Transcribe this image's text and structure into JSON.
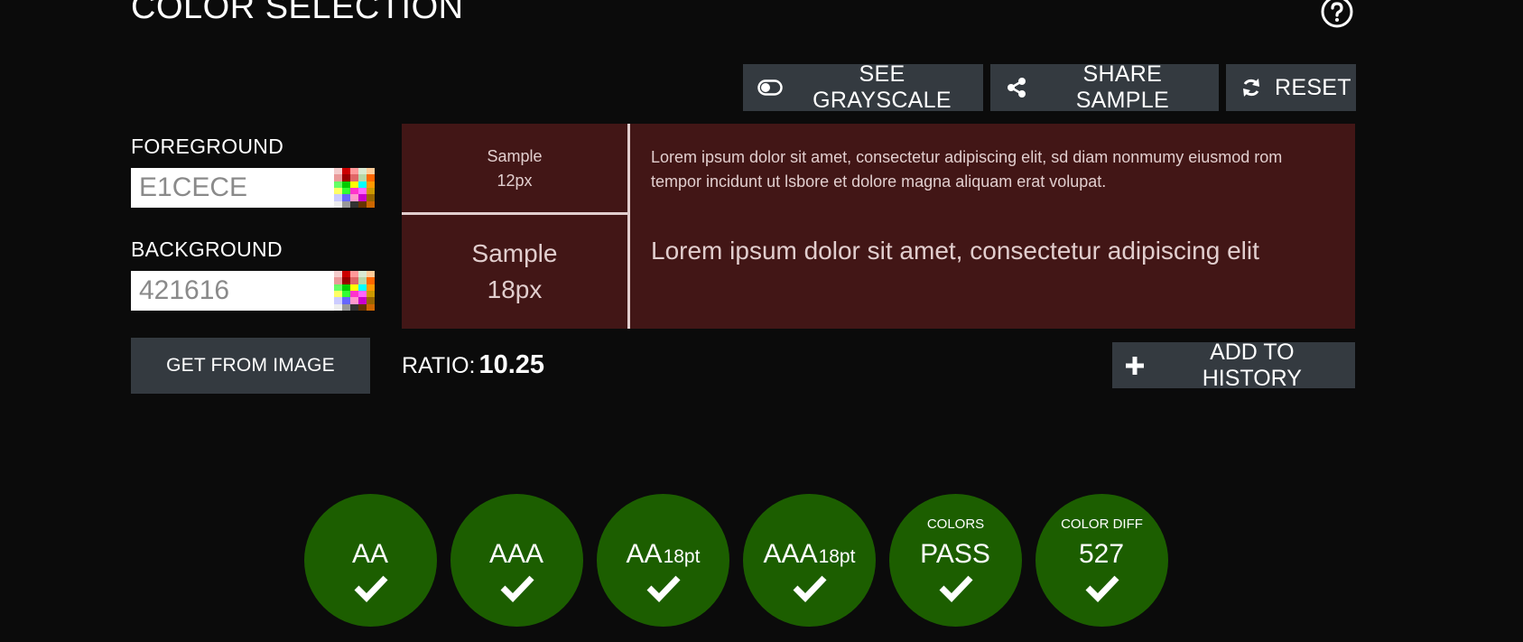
{
  "page": {
    "title": "COLOR SELECTION",
    "help_icon": "question-circle-icon"
  },
  "toolbar": {
    "grayscale": {
      "label": "SEE GRAYSCALE",
      "icon": "toggle-icon"
    },
    "share": {
      "label": "SHARE SAMPLE",
      "icon": "share-icon"
    },
    "reset": {
      "label": "RESET",
      "icon": "refresh-icon"
    }
  },
  "foreground": {
    "label": "FOREGROUND",
    "value": "E1CECE",
    "color": "#E1CECE",
    "palette_icon": "color-palette-icon"
  },
  "background": {
    "label": "BACKGROUND",
    "value": "421616",
    "color": "#421616",
    "palette_icon": "color-palette-icon"
  },
  "get_from_image": {
    "label": "GET FROM IMAGE"
  },
  "preview": {
    "sample_small": {
      "line1": "Sample",
      "line2": "12px"
    },
    "sample_large": {
      "line1": "Sample",
      "line2": "18px"
    },
    "text_small": "Lorem ipsum dolor sit amet, consectetur adipiscing elit, sd diam nonmumy eiusmod rom tempor incidunt ut lsbore et dolore magna aliquam erat volupat.",
    "text_large": "Lorem ipsum dolor sit amet, consectetur adipiscing elit"
  },
  "ratio": {
    "label": "RATIO:",
    "value": "10.25"
  },
  "history": {
    "label": "ADD TO HISTORY",
    "icon": "plus-icon"
  },
  "badges": [
    {
      "small": "",
      "main": "AA",
      "suffix": "",
      "status": "pass",
      "icon": "check-icon"
    },
    {
      "small": "",
      "main": "AAA",
      "suffix": "",
      "status": "pass",
      "icon": "check-icon"
    },
    {
      "small": "",
      "main": "AA",
      "suffix": "18pt",
      "status": "pass",
      "icon": "check-icon"
    },
    {
      "small": "",
      "main": "AAA",
      "suffix": "18pt",
      "status": "pass",
      "icon": "check-icon"
    },
    {
      "small": "COLORS",
      "main": "PASS",
      "suffix": "",
      "status": "pass",
      "icon": "check-icon"
    },
    {
      "small": "COLOR DIFF",
      "main": "527",
      "suffix": "",
      "status": "pass",
      "icon": "check-icon"
    }
  ],
  "colors": {
    "page_background": "#0b0b0b",
    "button": "#343a40",
    "badge_pass": "#1c5e00"
  }
}
